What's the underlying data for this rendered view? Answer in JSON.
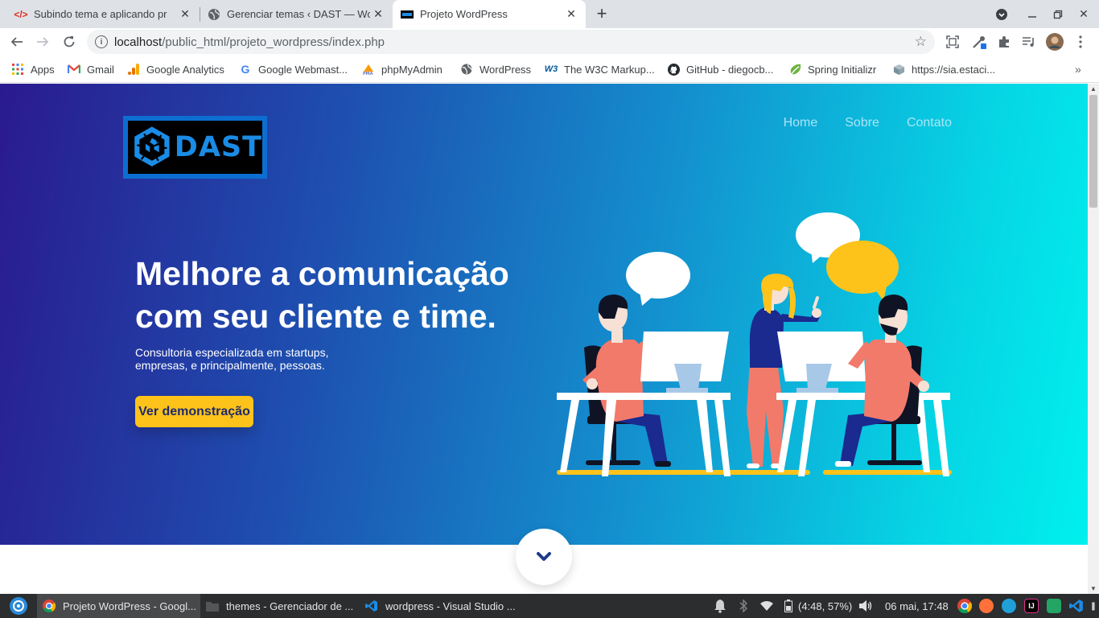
{
  "browser": {
    "tabs": [
      {
        "title": "Subindo tema e aplicando pr",
        "icon": "code-icon",
        "active": false
      },
      {
        "title": "Gerenciar temas ‹ DAST — Wo",
        "icon": "globe-icon",
        "active": false
      },
      {
        "title": "Projeto WordPress",
        "icon": "dast-favicon-icon",
        "active": true
      }
    ],
    "url_host": "localhost",
    "url_path": "/public_html/projeto_wordpress/index.php",
    "bookmarks": [
      {
        "label": "Apps",
        "icon": "apps-grid-icon"
      },
      {
        "label": "Gmail",
        "icon": "gmail-icon"
      },
      {
        "label": "Google Analytics",
        "icon": "analytics-icon"
      },
      {
        "label": "Google Webmast...",
        "icon": "google-icon"
      },
      {
        "label": "phpMyAdmin",
        "icon": "phpmyadmin-icon"
      },
      {
        "label": "WordPress",
        "icon": "globe-icon"
      },
      {
        "label": "The W3C Markup...",
        "icon": "w3c-icon"
      },
      {
        "label": "GitHub - diegocb...",
        "icon": "github-icon"
      },
      {
        "label": "Spring Initializr",
        "icon": "spring-icon"
      },
      {
        "label": "https://sia.estaci...",
        "icon": "cube-icon"
      }
    ]
  },
  "site": {
    "logo_text": "DAST",
    "nav": [
      "Home",
      "Sobre",
      "Contato"
    ],
    "headline": "Melhore a comunicação com seu cliente e time.",
    "subtext": "Consultoria especializada em startups, empresas, e principalmente, pessoas.",
    "cta_label": "Ver demonstração"
  },
  "taskbar": {
    "windows": [
      {
        "title": "Projeto WordPress - Googl...",
        "icon": "chrome-icon",
        "active": true
      },
      {
        "title": "themes - Gerenciador de ...",
        "icon": "folder-icon",
        "active": false
      },
      {
        "title": "wordpress - Visual Studio ...",
        "icon": "vscode-icon",
        "active": false
      }
    ],
    "battery": "(4:48, 57%)",
    "clock": "06 mai, 17:48"
  },
  "colors": {
    "hero_start": "#2a1a8f",
    "hero_end": "#00f0ee",
    "cta": "#fdc31a",
    "logo_blue": "#0d6ed1"
  }
}
